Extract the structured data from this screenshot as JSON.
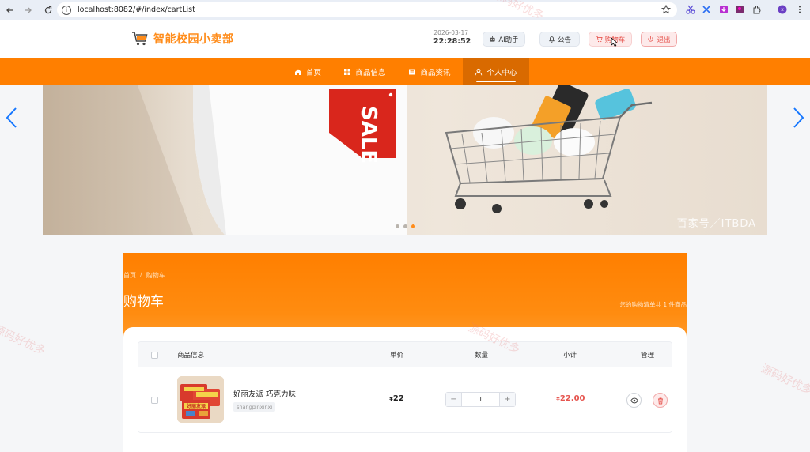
{
  "browser": {
    "url": "localhost:8082/#/index/cartList"
  },
  "header": {
    "site_name": "智能校园小卖部",
    "date": "2026-03-17",
    "time": "22:28:52",
    "ai_label": "AI助手",
    "notice_label": "公告",
    "cart_label": "购物车",
    "logout_label": "退出"
  },
  "nav": {
    "items": [
      {
        "label": "首页",
        "icon": "home-icon"
      },
      {
        "label": "商品信息",
        "icon": "grid-icon"
      },
      {
        "label": "商品资讯",
        "icon": "news-icon"
      },
      {
        "label": "个人中心",
        "icon": "user-icon",
        "active": true
      }
    ]
  },
  "banner": {
    "sale_text": "SALE",
    "watermark": "百家号／ITBDA",
    "slides": 3,
    "active_slide": 3
  },
  "cart_page": {
    "breadcrumb": [
      "首页",
      "购物车"
    ],
    "title": "购物车",
    "summary": "您的购物清单共 1 件商品",
    "columns": {
      "product": "商品信息",
      "price": "单价",
      "quantity": "数量",
      "subtotal": "小计",
      "manage": "管理"
    },
    "items": [
      {
        "name": "好丽友派 巧克力味",
        "tag": "shangpinxinxi",
        "currency": "¥",
        "price": "22",
        "quantity": "1",
        "subtotal": "22.00",
        "thumb_text": "好丽友派"
      }
    ],
    "minus": "−",
    "plus": "+"
  },
  "watermark_text": "源码好优多",
  "colors": {
    "primary_orange": "#ff7f00",
    "logo_orange": "#ff8c1a",
    "danger_red": "#e6554f",
    "nav_active": "#d96a00"
  }
}
